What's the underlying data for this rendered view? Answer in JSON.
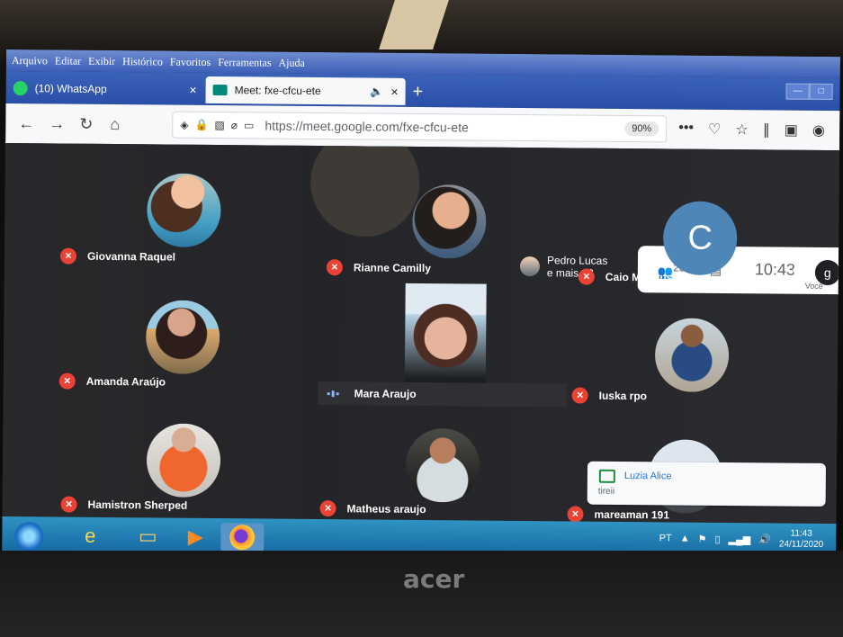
{
  "browser": {
    "menu": [
      "Arquivo",
      "Editar",
      "Exibir",
      "Histórico",
      "Favoritos",
      "Ferramentas",
      "Ajuda"
    ],
    "tabs": [
      {
        "label": "(10) WhatsApp",
        "close": "×"
      },
      {
        "label": "Meet: fxe-cfcu-ete",
        "close": "×"
      }
    ],
    "new_tab": "+",
    "url": "https://meet.google.com/fxe-cfcu-ete",
    "zoom": "90%"
  },
  "meeting": {
    "participants": [
      {
        "name": "Giovanna Raquel"
      },
      {
        "name": "Rianne Camilly"
      },
      {
        "name": "Caio Magnus"
      },
      {
        "name": "Amanda Araújo"
      },
      {
        "name": "Mara Araujo"
      },
      {
        "name": "Iuska rpo"
      },
      {
        "name": "Hamistron Sherped"
      },
      {
        "name": "Matheus araujo"
      },
      {
        "name": "mareaman 191"
      }
    ],
    "caio_initial": "C",
    "top_participant": "Pedro Lucas",
    "more_label": "e mais 12",
    "participant_count": "23",
    "time": "10:43",
    "you_label": "Você",
    "you_initial": "g"
  },
  "notification": {
    "sender": "Luzia Alice",
    "message": "tireii"
  },
  "taskbar": {
    "language": "PT",
    "time": "11:43",
    "date": "24/11/2020"
  },
  "monitor": {
    "brand": "acer"
  }
}
